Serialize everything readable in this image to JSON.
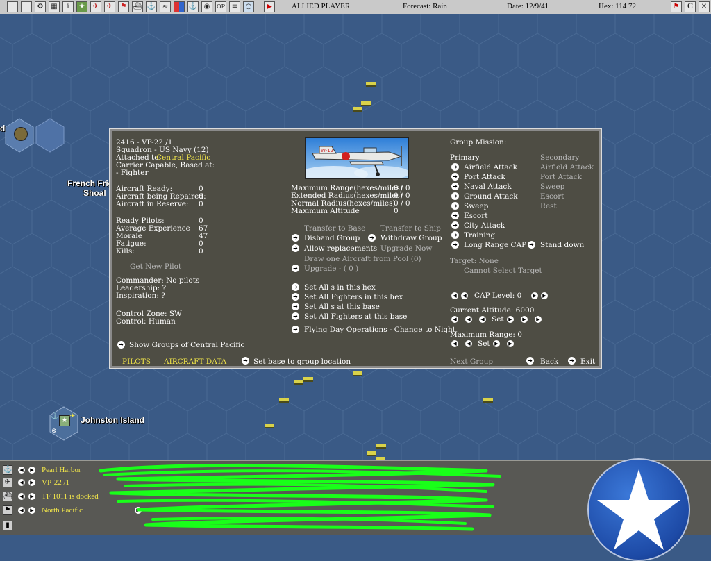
{
  "topbar": {
    "icons": [
      "window-icon",
      "document-icon",
      "cog-icon",
      "grid-icon",
      "info-icon",
      "star-icon",
      "plane-icon",
      "bomber-icon",
      "flag-icon",
      "ship-icon",
      "anchor-icon",
      "sub-icon",
      "color-icon",
      "fleet-icon",
      "globe-icon",
      "op-icon",
      "list-icon",
      "ring-icon",
      "play-icon"
    ],
    "op_label": "OP",
    "player": "ALLIED PLAYER",
    "forecast": "Forecast: Rain",
    "date": "Date: 12/9/41",
    "hex": "Hex: 114  72",
    "right_icons": [
      "flag-red-icon",
      "c-icon",
      "close-icon"
    ],
    "c_label": "C"
  },
  "map": {
    "labels": {
      "french_frigate": "French Frig",
      "shoal": "Shoal",
      "johnston": "Johnston Island",
      "left_edge": "d"
    }
  },
  "dialog": {
    "unit_id": "2416 - VP-22 /1",
    "squadron": "Squadron - US Navy (12)",
    "attached_label": "Attached to:",
    "attached_value": "Central Pacific",
    "carrier_capable": "Carrier Capable, Based at:",
    "fighter": "- Fighter",
    "stats": [
      {
        "label": "Aircraft Ready:",
        "value": "0"
      },
      {
        "label": "Aircraft being Repaired:",
        "value": "0"
      },
      {
        "label": "Aircraft in Reserve:",
        "value": "0"
      }
    ],
    "pilot_stats": [
      {
        "label": "Ready Pilots:",
        "value": "0"
      },
      {
        "label": "Average Experience",
        "value": "67"
      },
      {
        "label": "Morale",
        "value": "47"
      },
      {
        "label": "Fatigue:",
        "value": "0"
      },
      {
        "label": "Kills:",
        "value": "0"
      }
    ],
    "get_new_pilot": "Get New Pilot",
    "commander": "Commander:  No pilots",
    "leadership": "Leadership: ?",
    "inspiration": "Inspiration: ?",
    "control_zone": "Control Zone: SW",
    "control": "Control:     Human",
    "show_groups": "Show Groups of Central Pacific",
    "tabs": {
      "pilots": "PILOTS",
      "aircraft_data": "AIRCRAFT DATA"
    },
    "set_base": "Set base to group location",
    "ranges": [
      {
        "label": "Maximum Range(hexes/miles)",
        "value": "0 / 0"
      },
      {
        "label": "Extended Radius(hexes/miles)",
        "value": "0 / 0"
      },
      {
        "label": "Normal Radius(hexes/miles)",
        "value": "0 / 0"
      },
      {
        "label": "Maximum Altitude",
        "value": "0"
      }
    ],
    "transfer_base": "Transfer to Base",
    "transfer_ship": "Transfer to Ship",
    "disband": "Disband Group",
    "withdraw": "Withdraw Group",
    "allow_replacements": "Allow replacements",
    "upgrade_now": "Upgrade Now",
    "draw_aircraft": "Draw one Aircraft from Pool (0)",
    "upgrade": "Upgrade -   ( 0 )",
    "set_all_s_hex": "Set All s in this hex",
    "set_all_fighters_hex": "Set All Fighters in this hex",
    "set_all_s_base": "Set All s at this base",
    "set_all_fighters_base": "Set All Fighters at this base",
    "flying_day": "Flying Day Operations - Change to Night",
    "group_mission": "Group Mission:",
    "primary": "Primary",
    "secondary": "Secondary",
    "primary_missions": [
      "Airfield Attack",
      "Port Attack",
      "Naval Attack",
      "Ground Attack",
      "Sweep",
      "Escort",
      "City Attack",
      "Training",
      "Long Range CAP"
    ],
    "secondary_missions": [
      "Airfield Attack",
      "Port Attack",
      "Sweep",
      "Escort",
      "Rest"
    ],
    "stand_down": "Stand down",
    "target": "Target: None",
    "cannot_select": "Cannot Select Target",
    "cap_level": "CAP Level: 0",
    "current_altitude": "Current Altitude: 6000",
    "set": "Set",
    "maximum_range": "Maximum Range: 0",
    "next_group": "Next Group",
    "back": "Back",
    "exit": "Exit"
  },
  "bottombar": {
    "rows": [
      {
        "icon": "anchor-icon",
        "label": "Pearl Harbor"
      },
      {
        "icon": "plane-icon",
        "label": "VP-22 /1"
      },
      {
        "icon": "ship-icon",
        "label": "TF 1011 is docked"
      },
      {
        "icon": "flag-icon",
        "label": "North Pacific"
      }
    ],
    "emblem": "us-star-icon"
  },
  "colors": {
    "ocean": "#3a5a86",
    "dialog_bg": "#4e4d44",
    "highlight_yellow": "#f2e64a",
    "scribble_green": "#19ff19"
  }
}
